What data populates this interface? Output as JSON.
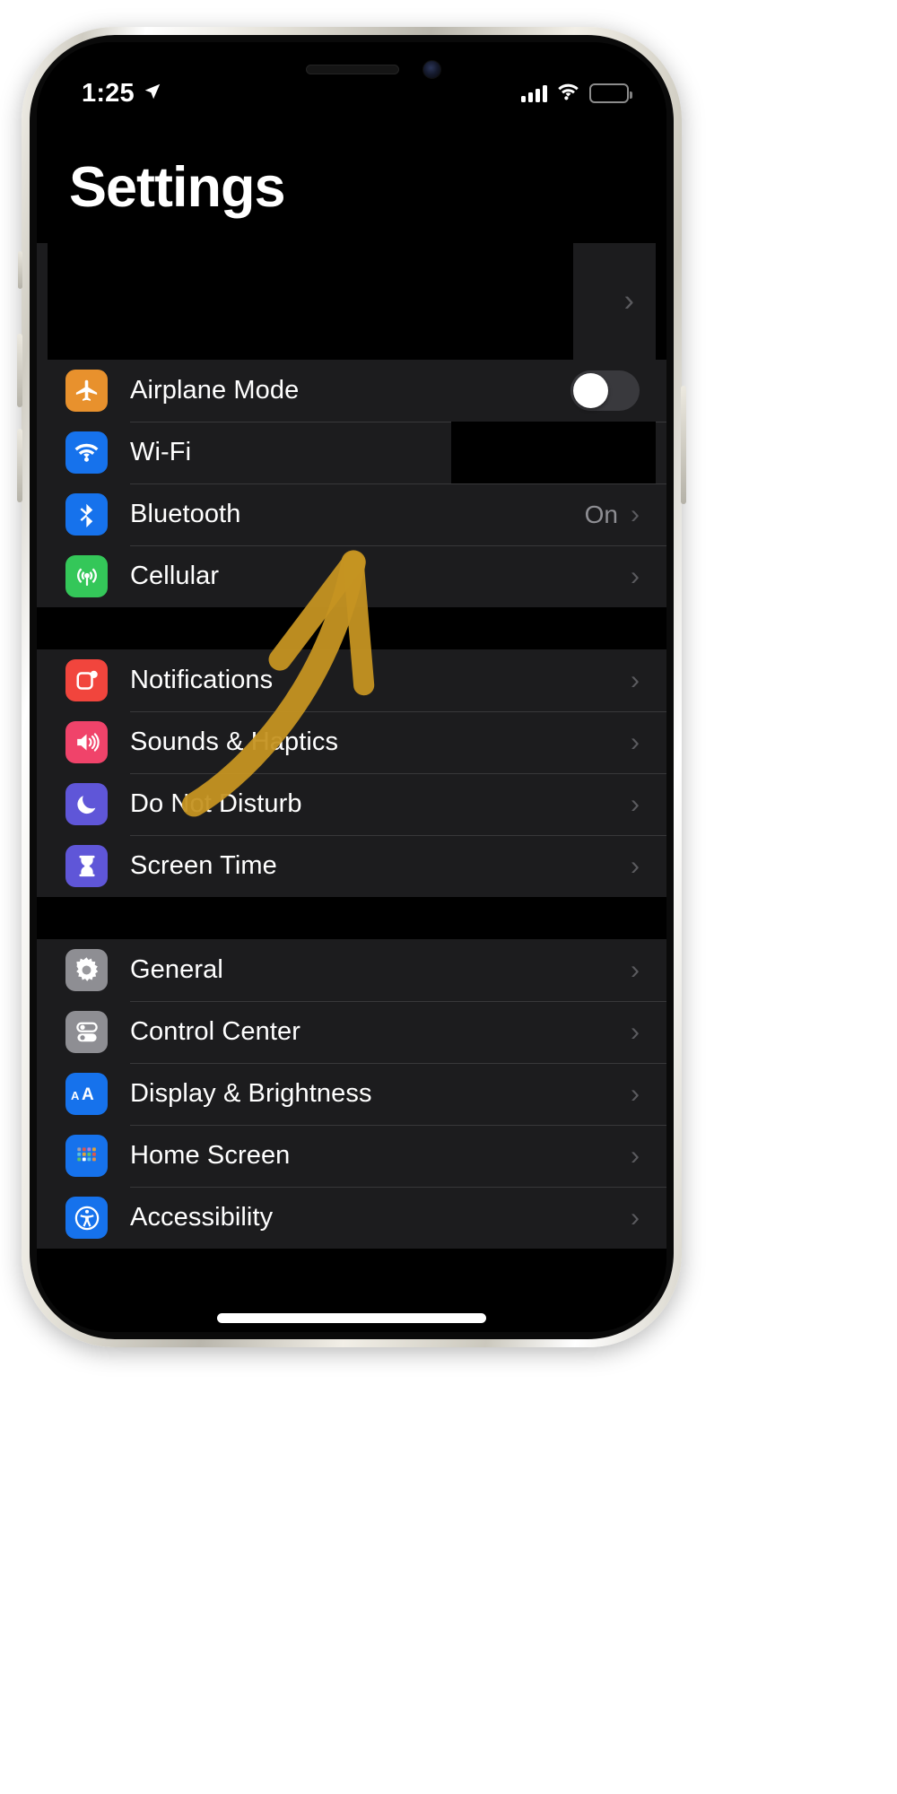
{
  "status_bar": {
    "time": "1:25",
    "location_icon": "location-arrow-icon",
    "signal_icon": "cellular-signal-icon",
    "wifi_icon": "wifi-icon",
    "battery_icon": "battery-icon"
  },
  "header": {
    "title": "Settings"
  },
  "apple_id_row": {
    "redacted": "",
    "chevron": "›"
  },
  "groups": [
    {
      "name": "connectivity",
      "rows": [
        {
          "label": "Airplane Mode",
          "icon": "airplane-icon",
          "icon_color": "#E8912D",
          "accessory": "toggle",
          "toggle_on": false,
          "value": ""
        },
        {
          "label": "Wi-Fi",
          "icon": "wifi-icon",
          "icon_color": "#1672EC",
          "accessory": "redacted",
          "value": ""
        },
        {
          "label": "Bluetooth",
          "icon": "bluetooth-icon",
          "icon_color": "#1672EC",
          "accessory": "chevron",
          "value": "On"
        },
        {
          "label": "Cellular",
          "icon": "cellular-antenna-icon",
          "icon_color": "#34C759",
          "accessory": "chevron",
          "value": ""
        }
      ]
    },
    {
      "name": "alerts",
      "rows": [
        {
          "label": "Notifications",
          "icon": "notifications-icon",
          "icon_color": "#F1453D",
          "accessory": "chevron",
          "value": ""
        },
        {
          "label": "Sounds & Haptics",
          "icon": "speaker-icon",
          "icon_color": "#F0436A",
          "accessory": "chevron",
          "value": ""
        },
        {
          "label": "Do Not Disturb",
          "icon": "moon-icon",
          "icon_color": "#5F56D8",
          "accessory": "chevron",
          "value": ""
        },
        {
          "label": "Screen Time",
          "icon": "hourglass-icon",
          "icon_color": "#5F56D8",
          "accessory": "chevron",
          "value": ""
        }
      ]
    },
    {
      "name": "system",
      "rows": [
        {
          "label": "General",
          "icon": "gear-icon",
          "icon_color": "#8E8E93",
          "accessory": "chevron",
          "value": ""
        },
        {
          "label": "Control Center",
          "icon": "control-center-icon",
          "icon_color": "#8E8E93",
          "accessory": "chevron",
          "value": ""
        },
        {
          "label": "Display & Brightness",
          "icon": "display-brightness-icon",
          "icon_color": "#1672EC",
          "accessory": "chevron",
          "value": ""
        },
        {
          "label": "Home Screen",
          "icon": "home-screen-icon",
          "icon_color": "#1672EC",
          "accessory": "chevron",
          "value": ""
        },
        {
          "label": "Accessibility",
          "icon": "accessibility-icon",
          "icon_color": "#1672EC",
          "accessory": "chevron",
          "value": ""
        }
      ]
    }
  ],
  "annotation": {
    "type": "hand-drawn-arrow",
    "color": "#C59422",
    "points_to": "Bluetooth"
  },
  "colors": {
    "screen_background": "#000000",
    "group_background": "#1c1c1e",
    "separator": "#38383a",
    "primary_text": "#ffffff",
    "secondary_text": "#8e8e93",
    "chevron": "#5a5a5e"
  }
}
